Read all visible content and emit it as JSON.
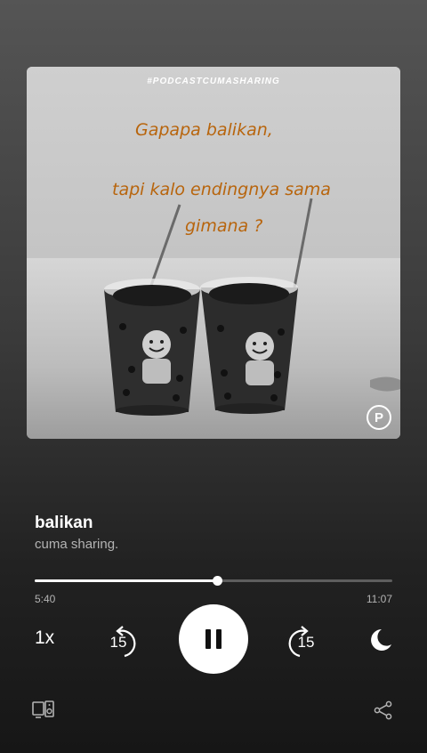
{
  "artwork": {
    "hashtag": "#PODCASTCUMASHARING",
    "lines": [
      "Gapapa balikan,",
      "tapi kalo endingnya sama",
      "gimana ?"
    ],
    "badge": "P"
  },
  "track": {
    "title": "balikan",
    "subtitle": "cuma sharing."
  },
  "playback": {
    "elapsed": "5:40",
    "total": "11:07",
    "progress_fraction": 0.51,
    "speed": "1x",
    "skip_back_seconds": "15",
    "skip_forward_seconds": "15"
  },
  "icons": {
    "sleep": "moon-icon",
    "devices": "connect-devices-icon",
    "share": "share-icon",
    "play_state": "pause-icon"
  },
  "colors": {
    "handwriting": "#b8650d",
    "primary": "#ffffff",
    "secondary": "#b3b3b3"
  }
}
